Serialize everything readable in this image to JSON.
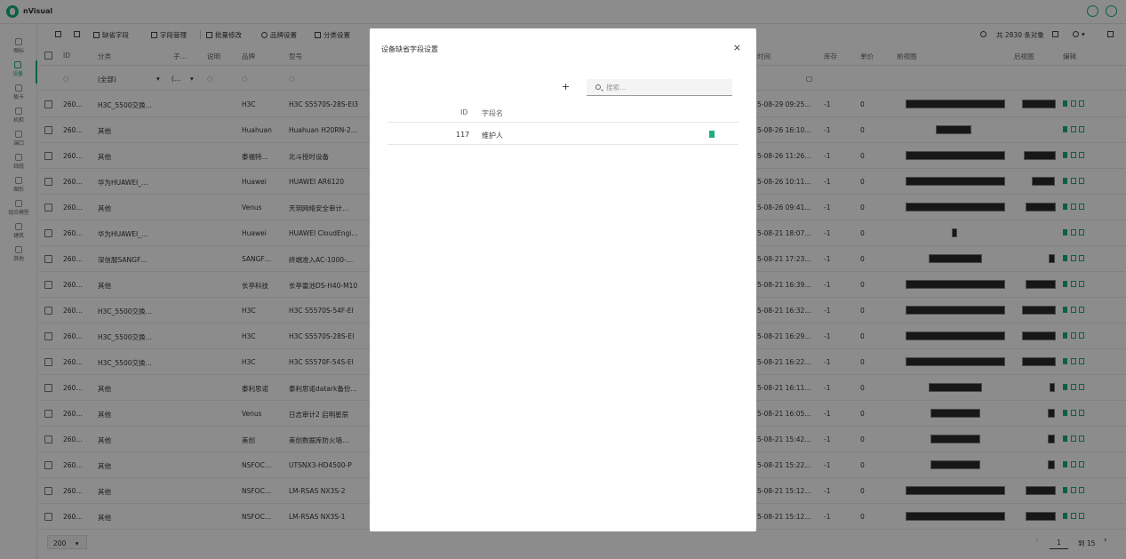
{
  "app": {
    "name": "nVisual"
  },
  "sidebar": {
    "items": [
      {
        "label": "图标",
        "icon": "dashboard-icon"
      },
      {
        "label": "设备",
        "icon": "device-icon",
        "active": true
      },
      {
        "label": "板卡",
        "icon": "card-icon"
      },
      {
        "label": "机柜",
        "icon": "cabinet-icon"
      },
      {
        "label": "端口",
        "icon": "port-icon"
      },
      {
        "label": "线缆",
        "icon": "cable-icon"
      },
      {
        "label": "图形",
        "icon": "shape-icon"
      },
      {
        "label": "组合模型",
        "icon": "combo-icon"
      },
      {
        "label": "建筑",
        "icon": "building-icon"
      },
      {
        "label": "其他",
        "icon": "other-icon"
      }
    ]
  },
  "toolbar": {
    "missing_fields": "缺省字段",
    "field_manage": "字段管理",
    "batch_edit": "批量修改",
    "brand_settings": "品牌设置",
    "category_settings": "分类设置",
    "total": "共 2830 条对象"
  },
  "table": {
    "headers": {
      "id": "ID",
      "category": "分类",
      "sub": "子…",
      "desc": "说明",
      "brand": "品牌",
      "model": "型号",
      "time": "时间",
      "stock": "库存",
      "price": "单价",
      "front": "前视图",
      "back": "后视图",
      "edit": "编辑"
    },
    "filters": {
      "category": "(全部)",
      "sub": "(…"
    },
    "rows": [
      {
        "id": "260…",
        "category": "H3C_5500交换…",
        "brand": "H3C",
        "model": "H3C S5570S-28S-EI3",
        "time": "5-08-29 09:25…",
        "stock": "-1",
        "price": "0"
      },
      {
        "id": "260…",
        "category": "其他",
        "brand": "Huahuan",
        "model": "Huahuan H20RN-2…",
        "time": "5-08-26 16:10…",
        "stock": "-1",
        "price": "0"
      },
      {
        "id": "260…",
        "category": "其他",
        "brand": "泰福特…",
        "model": "北斗授时设备",
        "time": "5-08-26 11:26…",
        "stock": "-1",
        "price": "0"
      },
      {
        "id": "260…",
        "category": "华为HUAWEI_…",
        "brand": "Huawei",
        "model": "HUAWEI AR6120",
        "time": "5-08-26 10:11…",
        "stock": "-1",
        "price": "0"
      },
      {
        "id": "260…",
        "category": "其他",
        "brand": "Venus",
        "model": "天玥网络安全审计…",
        "time": "5-08-26 09:41…",
        "stock": "-1",
        "price": "0"
      },
      {
        "id": "260…",
        "category": "华为HUAWEI_…",
        "brand": "Huawei",
        "model": "HUAWEI CloudEngi…",
        "time": "5-08-21 18:07…",
        "stock": "-1",
        "price": "0"
      },
      {
        "id": "260…",
        "category": "深信服SANGF…",
        "brand": "SANGF…",
        "model": "终端准入AC-1000-…",
        "time": "5-08-21 17:23…",
        "stock": "-1",
        "price": "0"
      },
      {
        "id": "260…",
        "category": "其他",
        "brand": "长亭科技",
        "model": "长亭雷池DS-H40-M10",
        "time": "5-08-21 16:39…",
        "stock": "-1",
        "price": "0"
      },
      {
        "id": "260…",
        "category": "H3C_5500交换…",
        "brand": "H3C",
        "model": "H3C S5570S-54F-EI",
        "time": "5-08-21 16:32…",
        "stock": "-1",
        "price": "0"
      },
      {
        "id": "260…",
        "category": "H3C_5500交换…",
        "brand": "H3C",
        "model": "H3C S5570S-28S-EI",
        "time": "5-08-21 16:29…",
        "stock": "-1",
        "price": "0"
      },
      {
        "id": "260…",
        "category": "H3C_5500交换…",
        "brand": "H3C",
        "model": "H3C S5570F-54S-EI",
        "time": "5-08-21 16:22…",
        "stock": "-1",
        "price": "0"
      },
      {
        "id": "260…",
        "category": "其他",
        "brand": "泰利思诺",
        "model": "泰利思诺datark备份…",
        "time": "5-08-21 16:11…",
        "stock": "-1",
        "price": "0"
      },
      {
        "id": "260…",
        "category": "其他",
        "brand": "Venus",
        "model": "日志审计2 启明星辰",
        "time": "5-08-21 16:05…",
        "stock": "-1",
        "price": "0"
      },
      {
        "id": "260…",
        "category": "其他",
        "brand": "美创",
        "model": "美创数据库防火墙…",
        "time": "5-08-21 15:42…",
        "stock": "-1",
        "price": "0"
      },
      {
        "id": "260…",
        "category": "其他",
        "brand": "NSFOC…",
        "model": "UTSNX3-HD4500-P",
        "time": "5-08-21 15:22…",
        "stock": "-1",
        "price": "0"
      },
      {
        "id": "260…",
        "category": "其他",
        "brand": "NSFOC…",
        "model": "LM-RSAS NX3S-2",
        "time": "5-08-21 15:12…",
        "stock": "-1",
        "price": "0"
      },
      {
        "id": "260…",
        "category": "其他",
        "brand": "NSFOC…",
        "model": "LM-RSAS NX3S-1",
        "time": "5-08-21 15:12…",
        "stock": "-1",
        "price": "0"
      }
    ]
  },
  "footer": {
    "page_size": "200",
    "page": "1",
    "total_pages": "到 15"
  },
  "modal": {
    "title": "设备缺省字段设置",
    "search_placeholder": "搜索…",
    "plus": "+",
    "close": "×",
    "headers": {
      "id": "ID",
      "name": "字段名"
    },
    "rows": [
      {
        "id": "117",
        "name": "维护人"
      }
    ]
  },
  "colors": {
    "accent": "#19b17b",
    "overlay": "rgba(0,0,0,0.45)"
  }
}
